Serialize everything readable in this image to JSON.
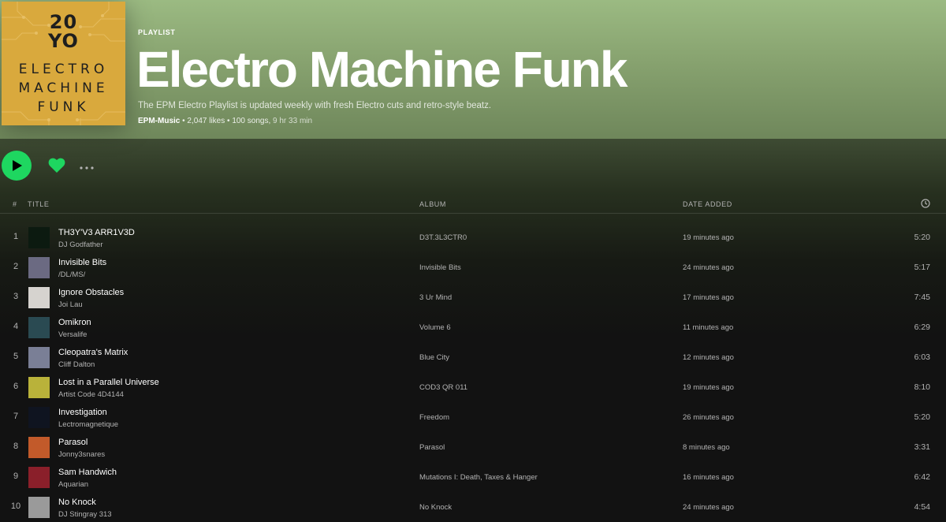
{
  "playlist": {
    "type_label": "PLAYLIST",
    "title": "Electro Machine Funk",
    "description": "The EPM Electro Playlist is updated weekly with fresh Electro cuts and retro-style beatz.",
    "owner": "EPM-Music",
    "likes": "2,047 likes",
    "songs": "100 songs,",
    "duration": "9 hr 33 min",
    "separator": "•"
  },
  "cover": {
    "logo_text": "20\nYO",
    "line1": "ELECTRO",
    "line2": "MACHINE",
    "line3": "FUNK",
    "background_color": "#d9a93d",
    "text_color": "#1e1e1e"
  },
  "actions": {
    "play_icon": "play-icon",
    "like_icon": "heart-icon",
    "more_icon": "more-horizontal-icon",
    "accent_color": "#1ed760"
  },
  "table": {
    "headers": {
      "number": "#",
      "title": "TITLE",
      "album": "ALBUM",
      "date_added": "DATE ADDED",
      "duration_icon": "clock-icon"
    },
    "tracks": [
      {
        "number": "1",
        "title": "TH3Y'V3 ARR1V3D",
        "artist": "DJ Godfather",
        "album": "D3T.3L3CTR0",
        "added": "19 minutes ago",
        "duration": "5:20",
        "thumb": "#0c1a10"
      },
      {
        "number": "2",
        "title": "Invisible Bits",
        "artist": "/DL/MS/",
        "album": "Invisible Bits",
        "added": "24 minutes ago",
        "duration": "5:17",
        "thumb": "#6b6a82"
      },
      {
        "number": "3",
        "title": "Ignore Obstacles",
        "artist": "Joi Lau",
        "album": "3 Ur Mind",
        "added": "17 minutes ago",
        "duration": "7:45",
        "thumb": "#d6d3cf"
      },
      {
        "number": "4",
        "title": "Omikron",
        "artist": "Versalife",
        "album": "Volume 6",
        "added": "11 minutes ago",
        "duration": "6:29",
        "thumb": "#2a4a52"
      },
      {
        "number": "5",
        "title": "Cleopatra's Matrix",
        "artist": "Cliff Dalton",
        "album": "Blue City",
        "added": "12 minutes ago",
        "duration": "6:03",
        "thumb": "#7a7f96"
      },
      {
        "number": "6",
        "title": "Lost in a Parallel Universe",
        "artist": "Artist Code 4D4144",
        "album": "COD3 QR 011",
        "added": "19 minutes ago",
        "duration": "8:10",
        "thumb": "#b9b23a"
      },
      {
        "number": "7",
        "title": "Investigation",
        "artist": "Lectromagnetique",
        "album": "Freedom",
        "added": "26 minutes ago",
        "duration": "5:20",
        "thumb": "#0f1420"
      },
      {
        "number": "8",
        "title": "Parasol",
        "artist": "Jonny3snares",
        "album": "Parasol",
        "added": "8 minutes ago",
        "duration": "3:31",
        "thumb": "#c25a2a"
      },
      {
        "number": "9",
        "title": "Sam Handwich",
        "artist": "Aquarian",
        "album": "Mutations I: Death, Taxes & Hanger",
        "added": "16 minutes ago",
        "duration": "6:42",
        "thumb": "#8a1f2a"
      },
      {
        "number": "10",
        "title": "No Knock",
        "artist": "DJ Stingray 313",
        "album": "No Knock",
        "added": "24 minutes ago",
        "duration": "4:54",
        "thumb": "#9a9a9a"
      }
    ]
  }
}
